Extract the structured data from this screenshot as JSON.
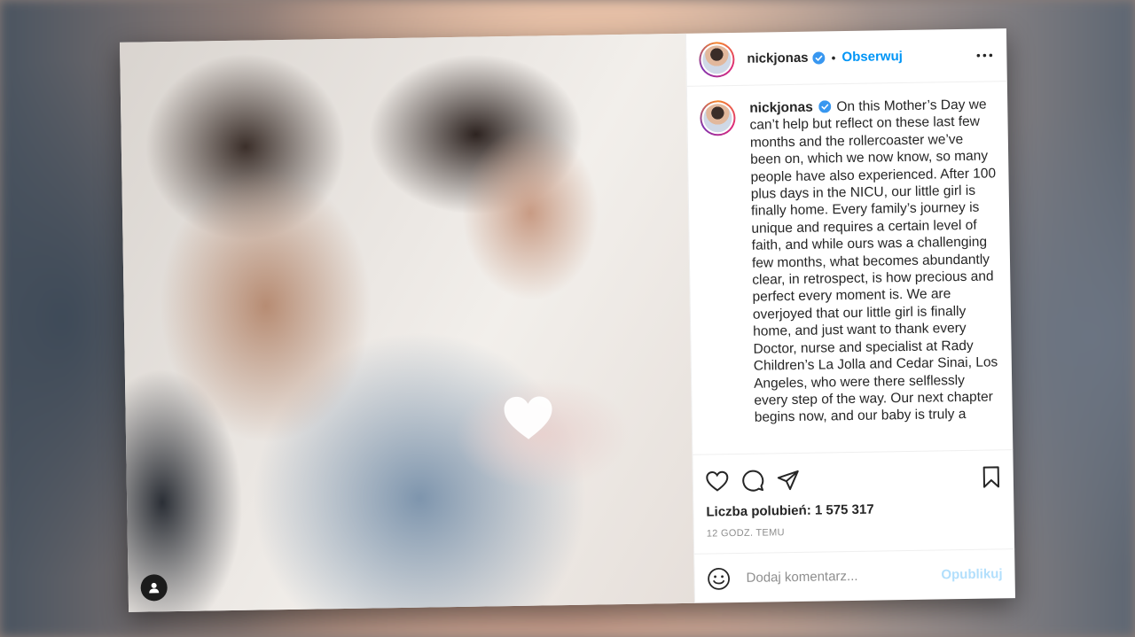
{
  "post": {
    "username": "nickjonas",
    "follow_label": "Obserwuj",
    "separator": "•",
    "caption_username": "nickjonas",
    "caption_text": "On this Mother’s Day we can’t help but reflect on these last few months and the rollercoaster we’ve been on, which we now know, so many people have also experienced. After 100 plus days in the NICU, our little girl is finally home. Every family’s journey is unique and requires a certain level of faith, and while ours was a challenging few months, what becomes abundantly clear, in retrospect, is how precious and perfect every moment is. We are overjoyed that our little girl is finally home, and just want to thank every Doctor, nurse and specialist at Rady Children’s La Jolla and Cedar Sinai, Los Angeles, who were there selflessly every step of the way. Our next chapter begins now, and our baby is truly a",
    "likes_label": "Liczba polubień: 1 575 317",
    "time_label": "12 GODZ. TEMU"
  },
  "comment": {
    "placeholder": "Dodaj komentarz...",
    "publish_label": "Opublikuj"
  },
  "colors": {
    "link_blue": "#0095f6",
    "publish_disabled": "#b2dffc",
    "verified_blue": "#3897f0"
  },
  "icons": [
    "verified-badge-icon",
    "more-options-icon",
    "heart-like-icon",
    "comment-icon",
    "share-icon",
    "bookmark-icon",
    "emoji-icon",
    "user-tag-icon",
    "heart-sticker-icon"
  ]
}
